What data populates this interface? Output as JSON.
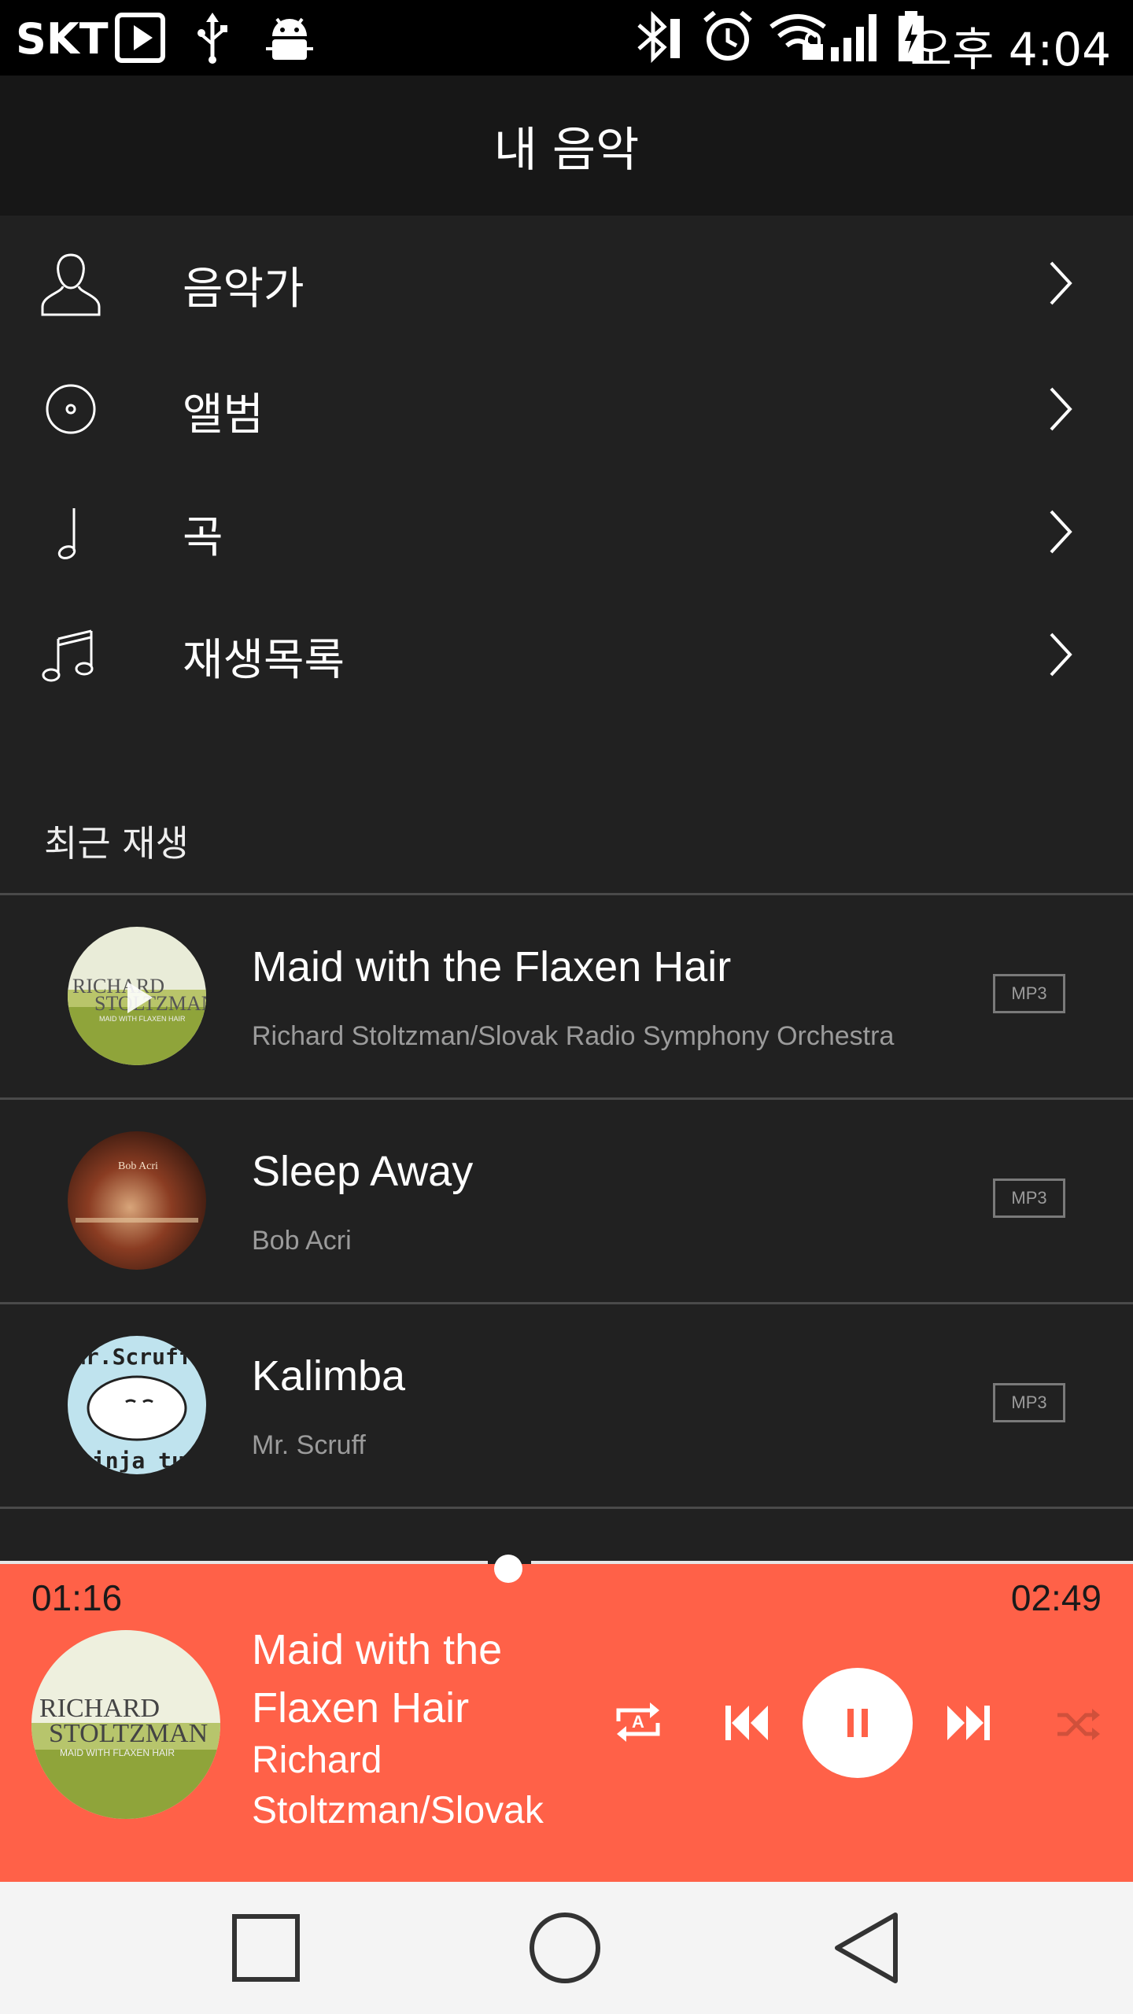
{
  "status_bar": {
    "carrier": "SKT",
    "time": "오후 4:04",
    "icons": [
      "play-store-icon",
      "usb-icon",
      "android-debug-icon",
      "bluetooth-icon",
      "alarm-icon",
      "wifi-lock-icon",
      "signal-icon",
      "battery-charging-icon"
    ]
  },
  "header": {
    "title": "내 음악"
  },
  "menu": {
    "items": [
      {
        "label": "음악가",
        "icon": "person-icon"
      },
      {
        "label": "앨범",
        "icon": "disc-icon"
      },
      {
        "label": "곡",
        "icon": "note-icon"
      },
      {
        "label": "재생목록",
        "icon": "playlist-icon"
      }
    ]
  },
  "recent": {
    "title": "최근 재생",
    "tracks": [
      {
        "title": "Maid with the Flaxen Hair",
        "artist": "Richard Stoltzman/Slovak Radio Symphony Orchestra",
        "format": "MP3",
        "art_text": [
          "RICHARD",
          "STOLTZMAN",
          "MAID WITH FLAXEN HAIR"
        ]
      },
      {
        "title": "Sleep Away",
        "artist": "Bob Acri",
        "format": "MP3",
        "art_text": [
          "Bob Acri"
        ]
      },
      {
        "title": "Kalimba",
        "artist": "Mr. Scruff",
        "format": "MP3",
        "art_text": [
          "Mr.Scruff",
          "ninja tun"
        ]
      }
    ]
  },
  "player": {
    "elapsed": "01:16",
    "duration": "02:49",
    "progress": 0.45,
    "title": "Maid with the Flaxen Hair",
    "artist": "Richard Stoltzman/Slovak",
    "art_text": [
      "RICHARD",
      "STOLTZMAN",
      "MAID WITH FLAXEN HAIR"
    ],
    "repeat_letter": "A",
    "accent": "#ff6148"
  },
  "nav": {
    "icons": [
      "recents-square-icon",
      "home-circle-icon",
      "back-triangle-icon"
    ]
  }
}
